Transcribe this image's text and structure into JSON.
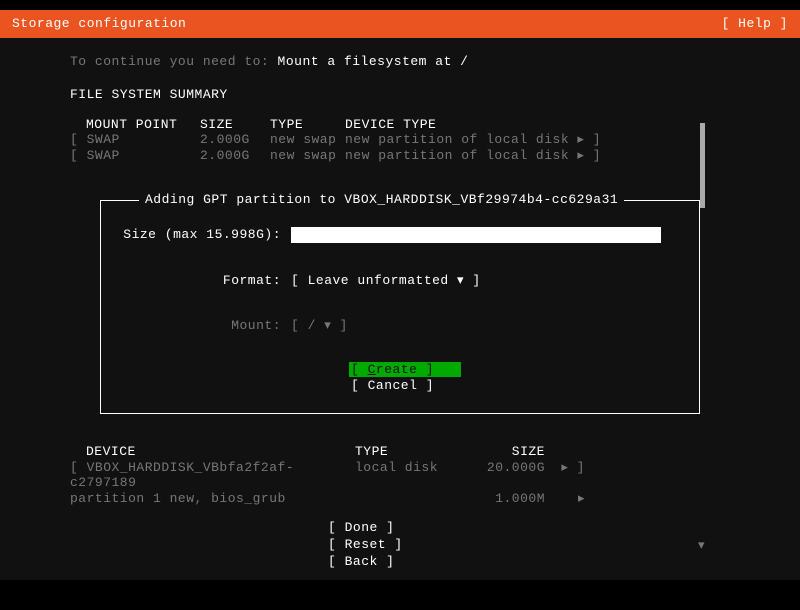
{
  "header": {
    "title": "Storage configuration",
    "help": "[ Help ]"
  },
  "instruction": {
    "prefix": "To continue you need to: ",
    "action": "Mount a filesystem at /"
  },
  "fs_summary": {
    "title": "FILE SYSTEM SUMMARY",
    "cols": {
      "mount": "MOUNT POINT",
      "size": "SIZE",
      "type": "TYPE",
      "device": "DEVICE TYPE"
    },
    "rows": [
      {
        "mount": "[ SWAP",
        "size": "2.000G",
        "type": "new swap",
        "device": "new partition of local disk ▸ ]"
      },
      {
        "mount": "[ SWAP",
        "size": "2.000G",
        "type": "new swap",
        "device": "new partition of local disk ▸ ]"
      }
    ]
  },
  "dialog": {
    "title": " Adding GPT partition to VBOX_HARDDISK_VBf29974b4-cc629a31 ",
    "size_label": "Size (max 15.998G):",
    "format_label": "Format:",
    "format_value": "[ Leave unformatted ▾ ]",
    "mount_label": "Mount:",
    "mount_value": "[ /              ▾ ]",
    "create_pre": "[ ",
    "create_letter": "C",
    "create_rest": "reate     ]",
    "cancel": "[ Cancel     ]"
  },
  "devices": {
    "cols": {
      "device": "DEVICE",
      "type": "TYPE",
      "size": "SIZE"
    },
    "rows": [
      {
        "device": "[ VBOX_HARDDISK_VBbfa2f2af-c2797189",
        "type": "local disk",
        "size": "20.000G",
        "arrow": "▸ ]"
      },
      {
        "device": "  partition 1  new, bios_grub",
        "type": "",
        "size": "1.000M",
        "arrow": "▸"
      }
    ],
    "scroll": "▾"
  },
  "footer": {
    "done": "[ Done       ]",
    "reset": "[ Reset      ]",
    "back": "[ Back       ]"
  }
}
